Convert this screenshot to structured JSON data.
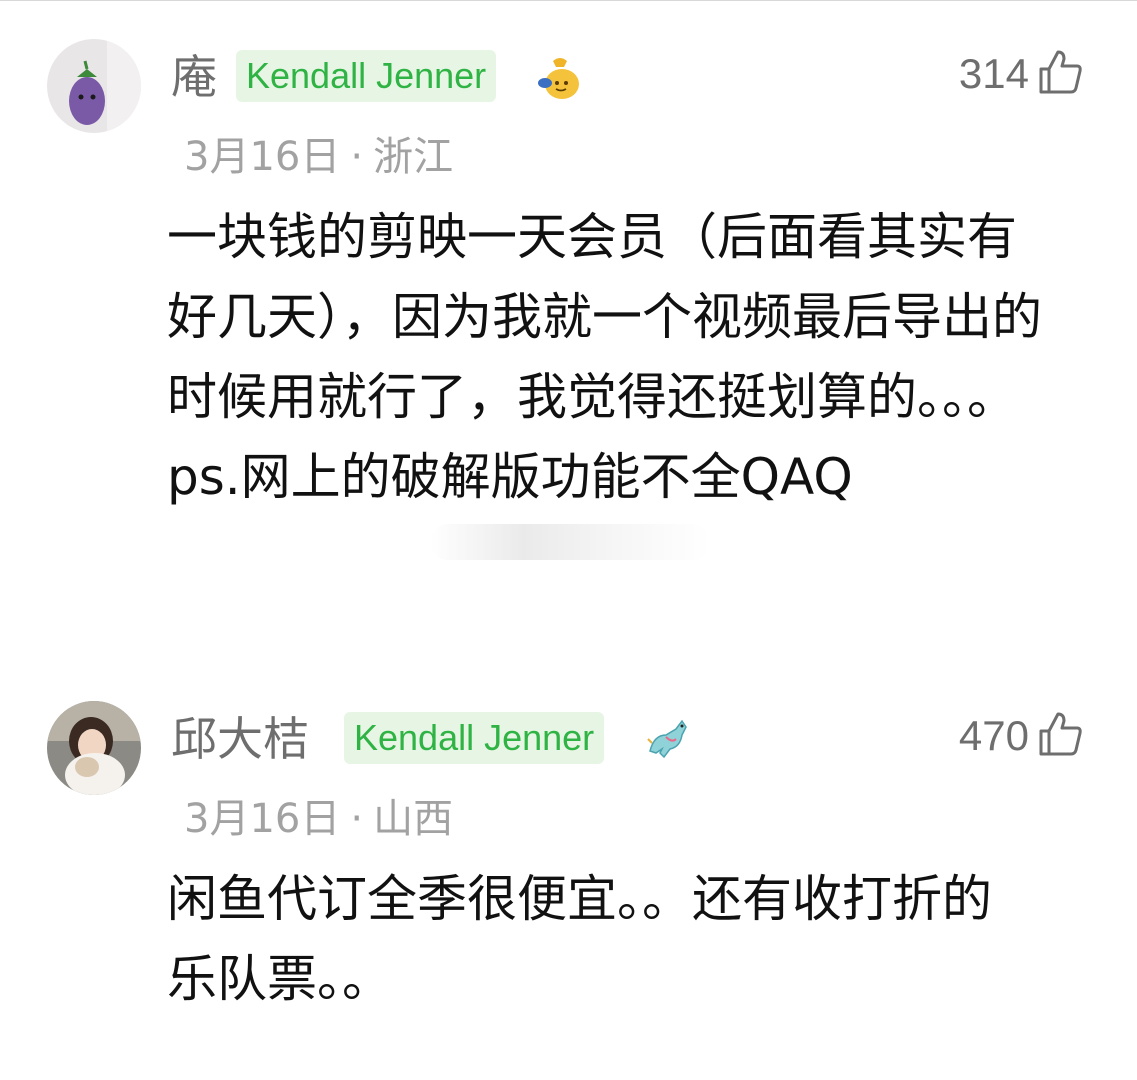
{
  "comments": [
    {
      "username": "庵",
      "tag": "Kendall Jenner",
      "badge_icon": "money-bag-icon",
      "like_count": "314",
      "date": "3月16日",
      "separator": "·",
      "location": "浙江",
      "text": "一块钱的剪映一天会员（后面看其实有好几天），因为我就一个视频最后导出的时候用就行了，我觉得还挺划算的。。。ps.网上的破解版功能不全QAQ"
    },
    {
      "username": "邱大桔",
      "tag": "Kendall Jenner",
      "badge_icon": "carousel-horse-icon",
      "like_count": "470",
      "date": "3月16日",
      "separator": "·",
      "location": "山西",
      "text": "闲鱼代订全季很便宜。。还有收打折的乐队票。。"
    }
  ],
  "colors": {
    "tag_bg": "#e7f6e4",
    "tag_text": "#2fb344",
    "meta": "#a2a2a2",
    "username": "#6e6e6e"
  }
}
